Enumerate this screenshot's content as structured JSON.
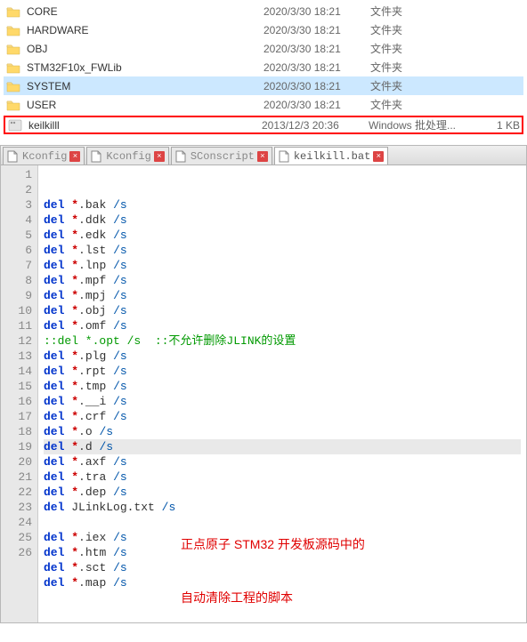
{
  "file_list": {
    "rows": [
      {
        "icon": "folder",
        "name": "CORE",
        "date": "2020/3/30 18:21",
        "type": "文件夹",
        "size": ""
      },
      {
        "icon": "folder",
        "name": "HARDWARE",
        "date": "2020/3/30 18:21",
        "type": "文件夹",
        "size": ""
      },
      {
        "icon": "folder",
        "name": "OBJ",
        "date": "2020/3/30 18:21",
        "type": "文件夹",
        "size": ""
      },
      {
        "icon": "folder",
        "name": "STM32F10x_FWLib",
        "date": "2020/3/30 18:21",
        "type": "文件夹",
        "size": ""
      },
      {
        "icon": "folder",
        "name": "SYSTEM",
        "date": "2020/3/30 18:21",
        "type": "文件夹",
        "size": "",
        "selected": true
      },
      {
        "icon": "folder",
        "name": "USER",
        "date": "2020/3/30 18:21",
        "type": "文件夹",
        "size": ""
      },
      {
        "icon": "bat",
        "name": "keilkilll",
        "date": "2013/12/3 20:36",
        "type": "Windows 批处理...",
        "size": "1 KB",
        "highlighted": true
      }
    ]
  },
  "editor": {
    "tabs": [
      {
        "label": "Kconfig",
        "active": false
      },
      {
        "label": "Kconfig",
        "active": false
      },
      {
        "label": "SConscript",
        "active": false
      },
      {
        "label": "keilkill.bat",
        "active": true
      }
    ],
    "lines": [
      {
        "n": 1,
        "kw": "del",
        "star": "*",
        "dot": ".",
        "ext": "bak",
        "sw": "/s"
      },
      {
        "n": 2,
        "kw": "del",
        "star": "*",
        "dot": ".",
        "ext": "ddk",
        "sw": "/s"
      },
      {
        "n": 3,
        "kw": "del",
        "star": "*",
        "dot": ".",
        "ext": "edk",
        "sw": "/s"
      },
      {
        "n": 4,
        "kw": "del",
        "star": "*",
        "dot": ".",
        "ext": "lst",
        "sw": "/s"
      },
      {
        "n": 5,
        "kw": "del",
        "star": "*",
        "dot": ".",
        "ext": "lnp",
        "sw": "/s"
      },
      {
        "n": 6,
        "kw": "del",
        "star": "*",
        "dot": ".",
        "ext": "mpf",
        "sw": "/s"
      },
      {
        "n": 7,
        "kw": "del",
        "star": "*",
        "dot": ".",
        "ext": "mpj",
        "sw": "/s"
      },
      {
        "n": 8,
        "kw": "del",
        "star": "*",
        "dot": ".",
        "ext": "obj",
        "sw": "/s"
      },
      {
        "n": 9,
        "kw": "del",
        "star": "*",
        "dot": ".",
        "ext": "omf",
        "sw": "/s"
      },
      {
        "n": 10,
        "cmt": "::del *.opt /s  ::不允许删除JLINK的设置"
      },
      {
        "n": 11,
        "kw": "del",
        "star": "*",
        "dot": ".",
        "ext": "plg",
        "sw": "/s"
      },
      {
        "n": 12,
        "kw": "del",
        "star": "*",
        "dot": ".",
        "ext": "rpt",
        "sw": "/s"
      },
      {
        "n": 13,
        "kw": "del",
        "star": "*",
        "dot": ".",
        "ext": "tmp",
        "sw": "/s"
      },
      {
        "n": 14,
        "kw": "del",
        "star": "*",
        "dot": ".",
        "ext": "__i",
        "sw": "/s"
      },
      {
        "n": 15,
        "kw": "del",
        "star": "*",
        "dot": ".",
        "ext": "crf",
        "sw": "/s"
      },
      {
        "n": 16,
        "kw": "del",
        "star": "*",
        "dot": ".",
        "ext": "o",
        "sw": "/s"
      },
      {
        "n": 17,
        "kw": "del",
        "star": "*",
        "dot": ".",
        "ext": "d",
        "sw": "/s",
        "hl": true
      },
      {
        "n": 18,
        "kw": "del",
        "star": "*",
        "dot": ".",
        "ext": "axf",
        "sw": "/s"
      },
      {
        "n": 19,
        "kw": "del",
        "star": "*",
        "dot": ".",
        "ext": "tra",
        "sw": "/s"
      },
      {
        "n": 20,
        "kw": "del",
        "star": "*",
        "dot": ".",
        "ext": "dep",
        "sw": "/s"
      },
      {
        "n": 21,
        "kw": "del",
        "ext": "JLinkLog.txt",
        "sw": "/s"
      },
      {
        "n": 22,
        "blank": true
      },
      {
        "n": 23,
        "kw": "del",
        "star": "*",
        "dot": ".",
        "ext": "iex",
        "sw": "/s"
      },
      {
        "n": 24,
        "kw": "del",
        "star": "*",
        "dot": ".",
        "ext": "htm",
        "sw": "/s"
      },
      {
        "n": 25,
        "kw": "del",
        "star": "*",
        "dot": ".",
        "ext": "sct",
        "sw": "/s"
      },
      {
        "n": 26,
        "kw": "del",
        "star": "*",
        "dot": ".",
        "ext": "map",
        "sw": "/s"
      }
    ],
    "annotation": {
      "l1": "正点原子 STM32 开发板源码中的",
      "l2": "自动清除工程的脚本"
    }
  }
}
